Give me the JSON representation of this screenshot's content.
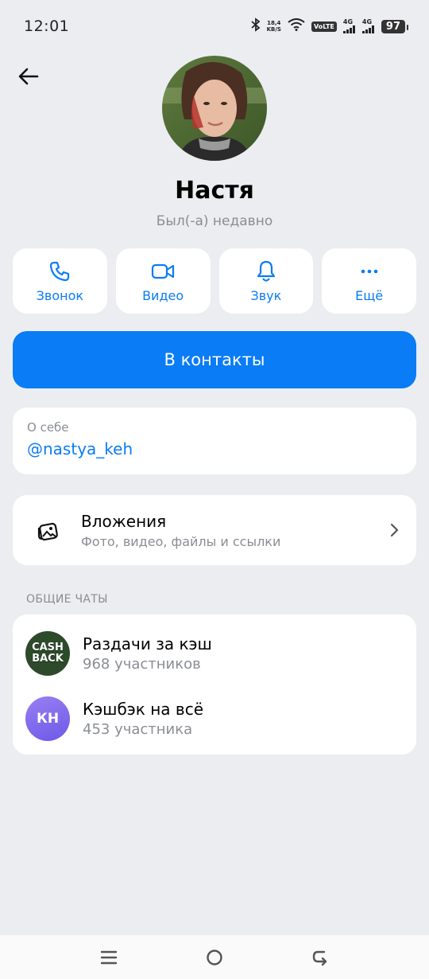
{
  "status": {
    "time": "12:01",
    "speed_value": "18,4",
    "speed_unit": "KB/S",
    "volte": "VoLTE",
    "sim1": "4G",
    "sim2": "4G",
    "battery": "97"
  },
  "profile": {
    "name": "Настя",
    "last_seen": "Был(-а) недавно"
  },
  "actions": [
    {
      "label": "Звонок",
      "icon": "phone-icon"
    },
    {
      "label": "Видео",
      "icon": "video-icon"
    },
    {
      "label": "Звук",
      "icon": "bell-icon"
    },
    {
      "label": "Ещё",
      "icon": "more-icon"
    }
  ],
  "contacts_button": "В контакты",
  "about": {
    "title": "О себе",
    "value": "@nastya_keh"
  },
  "attachments": {
    "title": "Вложения",
    "subtitle": "Фото, видео, файлы и ссылки"
  },
  "common_chats": {
    "label": "ОБЩИЕ ЧАТЫ",
    "items": [
      {
        "name": "Раздачи за кэш",
        "members": "968 участников",
        "avatar_line1": "CASH",
        "avatar_line2": "BACK"
      },
      {
        "name": "Кэшбэк на всё",
        "members": "453 участника",
        "avatar_initials": "КН"
      }
    ]
  },
  "colors": {
    "accent": "#0a7cf5",
    "background": "#ebedf0",
    "card": "#ffffff",
    "secondary_text": "#8a8d93"
  }
}
